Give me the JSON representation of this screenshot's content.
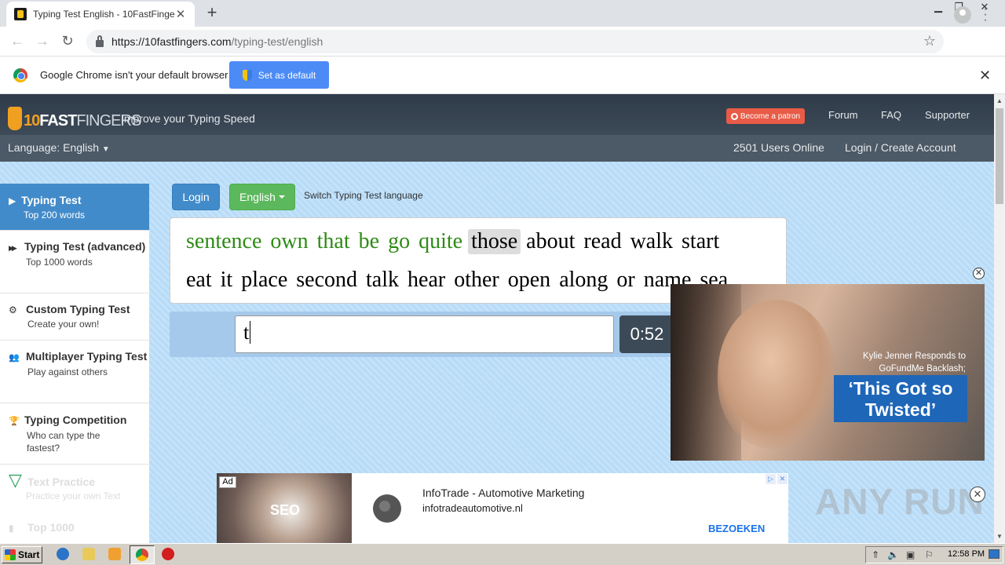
{
  "browser": {
    "tab_title": "Typing Test English - 10FastFingers.",
    "tab_close": "✕",
    "new_tab": "+",
    "url_host": "https://10fastfingers.com",
    "url_path": "/typing-test/english",
    "star_glyph": "☆",
    "window_min": "▁",
    "window_restore": "❐",
    "window_close": "✕"
  },
  "infobar": {
    "message": "Google Chrome isn't your default browser",
    "button_label": "Set as default",
    "close_glyph": "✕"
  },
  "site": {
    "logo_number": "10",
    "logo_fast": "FAST",
    "logo_fingers": "FINGERS",
    "tagline": "Improve your Typing Speed",
    "patron_label": "Become a patron",
    "nav": [
      "Forum",
      "FAQ",
      "Supporter"
    ],
    "language_label": "Language: English",
    "users_online": "2501 Users Online",
    "login_create": "Login / Create Account"
  },
  "sidebar": {
    "items": [
      {
        "title": "Typing Test",
        "sub": "Top 200 words",
        "icon": "play-icon",
        "glyph": "▶"
      },
      {
        "title": "Typing Test (advanced)",
        "sub": "Top 1000 words",
        "icon": "fast-forward-icon",
        "glyph": "▶▶"
      },
      {
        "title": "Custom Typing Test",
        "sub": "Create your own!",
        "icon": "cogs-icon",
        "glyph": "⚙"
      },
      {
        "title": "Multiplayer Typing Test",
        "sub": "Play against others",
        "icon": "users-icon",
        "glyph": "👥"
      },
      {
        "title": "Typing Competition",
        "sub": "Who can type the fastest?",
        "icon": "trophy-icon",
        "glyph": "🏆"
      },
      {
        "title": "Text Practice",
        "sub": "Practice your own Text",
        "icon": "filter-icon",
        "glyph": "▽"
      },
      {
        "title": "Top 1000",
        "sub": "",
        "icon": "bar-chart-icon",
        "glyph": "▮"
      }
    ]
  },
  "toolbar": {
    "login_label": "Login",
    "language_button": "English",
    "switch_text": "Switch Typing Test language"
  },
  "typing": {
    "line1_correct": [
      "sentence",
      "own",
      "that",
      "be",
      "go",
      "quite"
    ],
    "line1_current": "those",
    "line1_rest": [
      "about",
      "read",
      "walk",
      "start"
    ],
    "line2": [
      "eat",
      "it",
      "place",
      "second",
      "talk",
      "hear",
      "other",
      "open",
      "along",
      "or",
      "name",
      "sea"
    ],
    "input_value": "t",
    "timer": "0:52"
  },
  "video_ad": {
    "caption": "Kylie Jenner Responds to GoFundMe Backlash;",
    "headline": "‘This Got so Twisted’",
    "close_glyph": "✕"
  },
  "bottom_ad": {
    "badge": "Ad",
    "image_text": "SEO",
    "title": "InfoTrade - Automotive Marketing",
    "domain": "infotradeautomotive.nl",
    "cta": "BEZOEKEN",
    "choice_play": "▷",
    "choice_close": "✕",
    "close_glyph": "✕"
  },
  "watermark": "ANY RUN",
  "taskbar": {
    "start_label": "Start",
    "clock": "12:58 PM"
  },
  "colors": {
    "correct_word": "#2e8b15",
    "primary_blue": "#428bca",
    "success_green": "#5cb85c",
    "patron": "#e85b46"
  }
}
